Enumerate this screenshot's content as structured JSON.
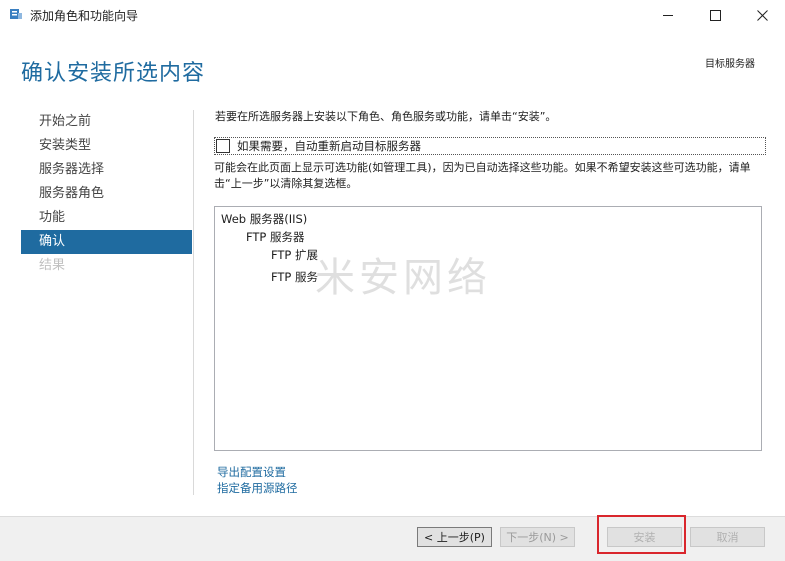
{
  "window": {
    "title": "添加角色和功能向导",
    "icon": "server-manager-icon",
    "controls": [
      "minimize-icon",
      "maximize-icon",
      "close-icon"
    ]
  },
  "header": {
    "title": "确认安装所选内容",
    "target_server": "目标服务器"
  },
  "nav": {
    "items": [
      {
        "label": "开始之前",
        "state": "normal"
      },
      {
        "label": "安装类型",
        "state": "normal"
      },
      {
        "label": "服务器选择",
        "state": "normal"
      },
      {
        "label": "服务器角色",
        "state": "normal"
      },
      {
        "label": "功能",
        "state": "normal"
      },
      {
        "label": "确认",
        "state": "active"
      },
      {
        "label": "结果",
        "state": "disabled"
      }
    ]
  },
  "content": {
    "instruction": "若要在所选服务器上安装以下角色、角色服务或功能，请单击“安装”。",
    "restart_label": "如果需要，自动重新启动目标服务器",
    "restart_checked": false,
    "notice": "可能会在此页面上显示可选功能(如管理工具)，因为已自动选择这些功能。如果不希望安装这些可选功能，请单击“上一步”以清除其复选框。",
    "features": [
      "Web 服务器(IIS)",
      "FTP 服务器",
      "FTP 扩展",
      "FTP 服务"
    ],
    "watermark": "米安网络",
    "links": {
      "export": "导出配置设置",
      "alternate_source": "指定备用源路径"
    }
  },
  "footer": {
    "prev": "< 上一步(P)",
    "next": "下一步(N) >",
    "install": "安装",
    "cancel": "取消"
  },
  "colors": {
    "accent": "#1f6ba0",
    "highlight": "#d9262c"
  }
}
